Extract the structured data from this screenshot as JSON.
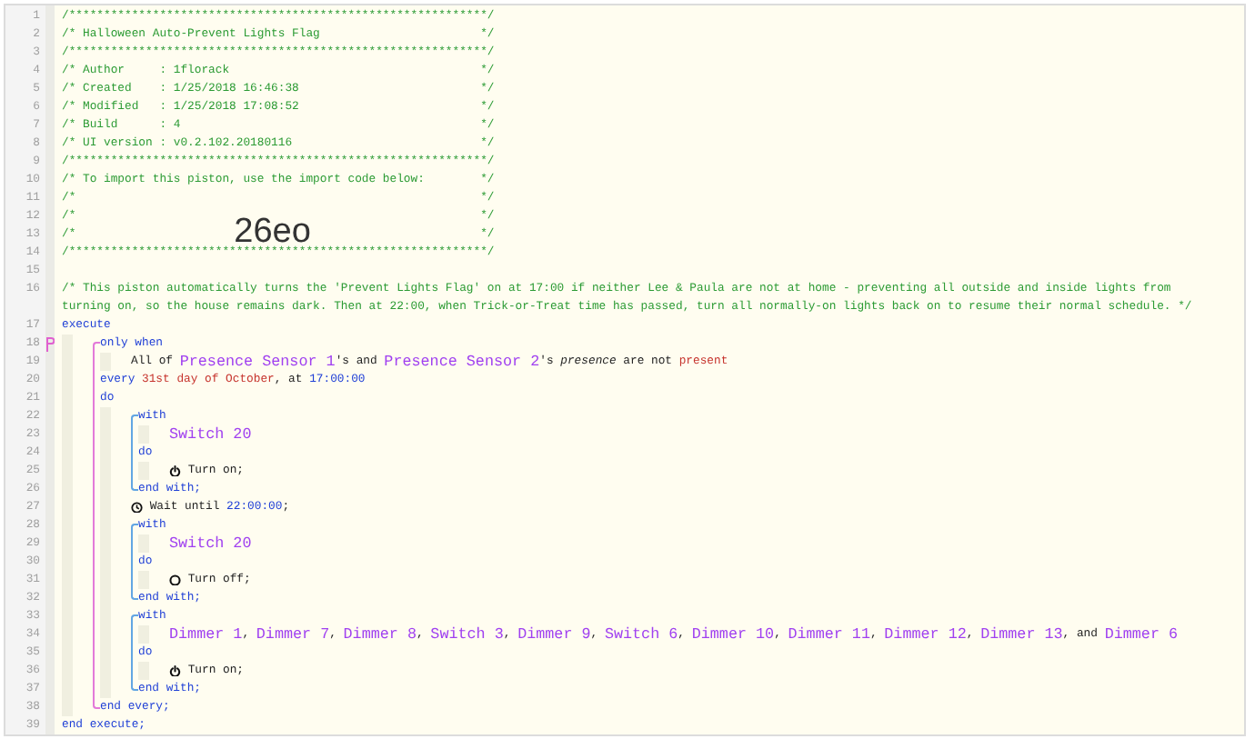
{
  "lines": [
    {
      "kind": "line",
      "number": "1",
      "marked": false,
      "segments": [
        {
          "kind": "comment",
          "text": "/************************************************************/"
        }
      ]
    },
    {
      "kind": "line",
      "number": "2",
      "marked": false,
      "segments": [
        {
          "kind": "comment",
          "text": "/* Halloween Auto-Prevent Lights Flag                       */"
        }
      ]
    },
    {
      "kind": "line",
      "number": "3",
      "marked": false,
      "segments": [
        {
          "kind": "comment",
          "text": "/************************************************************/"
        }
      ]
    },
    {
      "kind": "line",
      "number": "4",
      "marked": false,
      "segments": [
        {
          "kind": "comment",
          "text": "/* Author     : 1florack                                    */"
        }
      ]
    },
    {
      "kind": "line",
      "number": "5",
      "marked": false,
      "segments": [
        {
          "kind": "comment",
          "text": "/* Created    : 1/25/2018 16:46:38                          */"
        }
      ]
    },
    {
      "kind": "line",
      "number": "6",
      "marked": false,
      "segments": [
        {
          "kind": "comment",
          "text": "/* Modified   : 1/25/2018 17:08:52                          */"
        }
      ]
    },
    {
      "kind": "line",
      "number": "7",
      "marked": false,
      "segments": [
        {
          "kind": "comment",
          "text": "/* Build      : 4                                           */"
        }
      ]
    },
    {
      "kind": "line",
      "number": "8",
      "marked": false,
      "segments": [
        {
          "kind": "comment",
          "text": "/* UI version : v0.2.102.20180116                           */"
        }
      ]
    },
    {
      "kind": "line",
      "number": "9",
      "marked": false,
      "segments": [
        {
          "kind": "comment",
          "text": "/************************************************************/"
        }
      ]
    },
    {
      "kind": "line",
      "number": "10",
      "marked": false,
      "segments": [
        {
          "kind": "comment",
          "text": "/* To import this piston, use the import code below:        */"
        }
      ]
    },
    {
      "kind": "line",
      "number": "11",
      "marked": false,
      "segments": [
        {
          "kind": "comment",
          "text": "/*"
        },
        {
          "kind": "comment-end",
          "text": "*/"
        }
      ]
    },
    {
      "kind": "line",
      "number": "12",
      "marked": false,
      "segments": [
        {
          "kind": "comment",
          "text": "/*"
        },
        {
          "kind": "comment-end",
          "text": "*/"
        }
      ]
    },
    {
      "kind": "line",
      "number": "13",
      "marked": false,
      "segments": [
        {
          "kind": "comment",
          "text": "/*"
        },
        {
          "kind": "import",
          "text": "26eo"
        },
        {
          "kind": "comment-end",
          "text": "*/"
        }
      ]
    },
    {
      "kind": "line",
      "number": "14",
      "marked": false,
      "segments": [
        {
          "kind": "comment",
          "text": "/************************************************************/"
        }
      ]
    },
    {
      "kind": "line",
      "number": "15",
      "marked": false
    },
    {
      "kind": "line",
      "number": "16",
      "marked": false,
      "segments": [
        {
          "kind": "comment",
          "text": "/* This piston automatically turns the 'Prevent Lights Flag' on at 17:00 if neither Lee & Paula are not at home - preventing all outside and inside lights from turning on, so the house remains dark. Then at 22:00, when Trick-or-Treat time has passed, turn all normally-on lights back on to resume their normal schedule. */"
        }
      ]
    },
    {
      "kind": "line",
      "number": "17",
      "marked": false,
      "segments": [
        {
          "kind": "keyword",
          "text": "execute"
        }
      ],
      "children": [
        {
          "kind": "every-block",
          "lines": [
            {
              "kind": "line",
              "number": "18",
              "marked": true,
              "segments": [
                {
                  "kind": "keyword",
                  "text": "only when"
                }
              ],
              "children": [
                {
                  "kind": "line",
                  "number": "19",
                  "marked": false,
                  "segments": [
                    {
                      "kind": "text",
                      "text": "All of "
                    },
                    {
                      "kind": "device",
                      "text": "Presence Sensor 1"
                    },
                    {
                      "kind": "text",
                      "text": "'s and "
                    },
                    {
                      "kind": "device",
                      "text": "Presence Sensor 2"
                    },
                    {
                      "kind": "text",
                      "text": "'s "
                    },
                    {
                      "kind": "attribute",
                      "text": "presence"
                    },
                    {
                      "kind": "text",
                      "text": " are not "
                    },
                    {
                      "kind": "value",
                      "text": "present"
                    }
                  ]
                }
              ]
            },
            {
              "kind": "line",
              "number": "20",
              "marked": false,
              "segments": [
                {
                  "kind": "keyword",
                  "text": "every "
                },
                {
                  "kind": "value",
                  "text": "31st day of October"
                },
                {
                  "kind": "text",
                  "text": ", at "
                },
                {
                  "kind": "time",
                  "text": "17:00:00"
                }
              ]
            },
            {
              "kind": "line",
              "number": "21",
              "marked": false,
              "segments": [
                {
                  "kind": "keyword",
                  "text": "do"
                }
              ],
              "children": [
                {
                  "kind": "with-block",
                  "lines": [
                    {
                      "kind": "line",
                      "number": "22",
                      "marked": false,
                      "segments": [
                        {
                          "kind": "keyword",
                          "text": "with"
                        }
                      ],
                      "children": [
                        {
                          "kind": "line",
                          "number": "23",
                          "marked": false,
                          "segments": [
                            {
                              "kind": "device",
                              "text": "Switch 20"
                            }
                          ]
                        }
                      ]
                    },
                    {
                      "kind": "line",
                      "number": "24",
                      "marked": false,
                      "segments": [
                        {
                          "kind": "keyword",
                          "text": "do"
                        }
                      ],
                      "children": [
                        {
                          "kind": "line",
                          "number": "25",
                          "marked": false,
                          "segments": [
                            {
                              "kind": "power"
                            },
                            {
                              "kind": "text",
                              "text": " Turn on;"
                            }
                          ]
                        }
                      ]
                    },
                    {
                      "kind": "line",
                      "number": "26",
                      "marked": false,
                      "segments": [
                        {
                          "kind": "keyword",
                          "text": "end with;"
                        }
                      ]
                    }
                  ]
                },
                {
                  "kind": "line",
                  "number": "27",
                  "marked": false,
                  "segments": [
                    {
                      "kind": "clock"
                    },
                    {
                      "kind": "text",
                      "text": " Wait until "
                    },
                    {
                      "kind": "time",
                      "text": "22:00:00"
                    },
                    {
                      "kind": "text",
                      "text": ";"
                    }
                  ]
                },
                {
                  "kind": "with-block",
                  "lines": [
                    {
                      "kind": "line",
                      "number": "28",
                      "marked": false,
                      "segments": [
                        {
                          "kind": "keyword",
                          "text": "with"
                        }
                      ],
                      "children": [
                        {
                          "kind": "line",
                          "number": "29",
                          "marked": false,
                          "segments": [
                            {
                              "kind": "device",
                              "text": "Switch 20"
                            }
                          ]
                        }
                      ]
                    },
                    {
                      "kind": "line",
                      "number": "30",
                      "marked": false,
                      "segments": [
                        {
                          "kind": "keyword",
                          "text": "do"
                        }
                      ],
                      "children": [
                        {
                          "kind": "line",
                          "number": "31",
                          "marked": false,
                          "segments": [
                            {
                              "kind": "off"
                            },
                            {
                              "kind": "text",
                              "text": " Turn off;"
                            }
                          ]
                        }
                      ]
                    },
                    {
                      "kind": "line",
                      "number": "32",
                      "marked": false,
                      "segments": [
                        {
                          "kind": "keyword",
                          "text": "end with;"
                        }
                      ]
                    }
                  ]
                },
                {
                  "kind": "with-block",
                  "lines": [
                    {
                      "kind": "line",
                      "number": "33",
                      "marked": false,
                      "segments": [
                        {
                          "kind": "keyword",
                          "text": "with"
                        }
                      ],
                      "children": [
                        {
                          "kind": "line",
                          "number": "34",
                          "marked": false,
                          "segments": [
                            {
                              "kind": "device",
                              "text": "Dimmer 1"
                            },
                            {
                              "kind": "text",
                              "text": ", "
                            },
                            {
                              "kind": "device",
                              "text": "Dimmer 7"
                            },
                            {
                              "kind": "text",
                              "text": ", "
                            },
                            {
                              "kind": "device",
                              "text": "Dimmer 8"
                            },
                            {
                              "kind": "text",
                              "text": ", "
                            },
                            {
                              "kind": "device",
                              "text": "Switch 3"
                            },
                            {
                              "kind": "text",
                              "text": ", "
                            },
                            {
                              "kind": "device",
                              "text": "Dimmer 9"
                            },
                            {
                              "kind": "text",
                              "text": ", "
                            },
                            {
                              "kind": "device",
                              "text": "Switch 6"
                            },
                            {
                              "kind": "text",
                              "text": ", "
                            },
                            {
                              "kind": "device",
                              "text": "Dimmer 10"
                            },
                            {
                              "kind": "text",
                              "text": ", "
                            },
                            {
                              "kind": "device",
                              "text": "Dimmer 11"
                            },
                            {
                              "kind": "text",
                              "text": ", "
                            },
                            {
                              "kind": "device",
                              "text": "Dimmer 12"
                            },
                            {
                              "kind": "text",
                              "text": ", "
                            },
                            {
                              "kind": "device",
                              "text": "Dimmer 13"
                            },
                            {
                              "kind": "text",
                              "text": ", and "
                            },
                            {
                              "kind": "device",
                              "text": "Dimmer 6"
                            }
                          ]
                        }
                      ]
                    },
                    {
                      "kind": "line",
                      "number": "35",
                      "marked": false,
                      "segments": [
                        {
                          "kind": "keyword",
                          "text": "do"
                        }
                      ],
                      "children": [
                        {
                          "kind": "line",
                          "number": "36",
                          "marked": false,
                          "segments": [
                            {
                              "kind": "power"
                            },
                            {
                              "kind": "text",
                              "text": " Turn on;"
                            }
                          ]
                        }
                      ]
                    },
                    {
                      "kind": "line",
                      "number": "37",
                      "marked": false,
                      "segments": [
                        {
                          "kind": "keyword",
                          "text": "end with;"
                        }
                      ]
                    }
                  ]
                }
              ]
            },
            {
              "kind": "line",
              "number": "38",
              "marked": false,
              "segments": [
                {
                  "kind": "keyword",
                  "text": "end every;"
                }
              ]
            }
          ]
        }
      ]
    },
    {
      "kind": "line",
      "number": "39",
      "marked": false,
      "segments": [
        {
          "kind": "keyword",
          "text": "end execute;"
        }
      ]
    }
  ]
}
